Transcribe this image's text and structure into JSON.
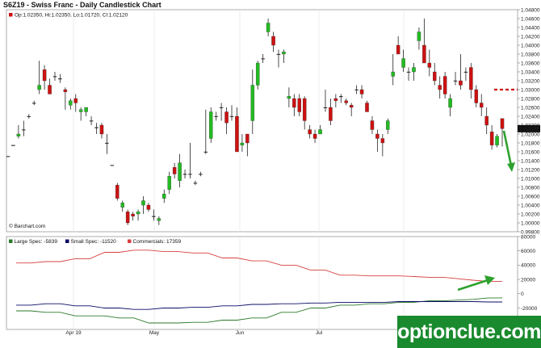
{
  "title": "S6Z19 - Swiss Franc - Daily Candlestick Chart",
  "ohlc_legend": "Op:1.02350, Hi:1.02350, Lo:1.01720, Cl:1.02120",
  "credit": "© Barchart.com",
  "last_price_label": "1.02120",
  "watermark": "optionclue.com",
  "colors": {
    "up": "#22bb22",
    "down": "#cc1111",
    "large_spec": "#2a7a2a",
    "small_spec": "#0b0b66",
    "commercials": "#d84040",
    "arrow": "#2ea12e",
    "resistance": "#cc1111"
  },
  "chart_data": [
    {
      "type": "candlestick",
      "title": "S6Z19 - Swiss Franc - Daily Candlestick Chart",
      "y_ticks": [
        "0.99800",
        "1.00000",
        "1.00200",
        "1.00400",
        "1.00600",
        "1.00800",
        "1.01000",
        "1.01200",
        "1.01400",
        "1.01600",
        "1.01800",
        "1.02000",
        "1.02200",
        "1.02400",
        "1.02600",
        "1.02800",
        "1.03000",
        "1.03200",
        "1.03400",
        "1.03600",
        "1.03800",
        "1.04000",
        "1.04200",
        "1.04400",
        "1.04600",
        "1.04800"
      ],
      "ylim": [
        0.998,
        1.048
      ],
      "x_labels": [
        "Apr 19",
        "May",
        "Jun",
        "Jul",
        "Aug"
      ],
      "candles": [
        [
          1.015,
          1.015,
          1.015,
          1.015
        ],
        [
          1.0175,
          1.0175,
          1.0175,
          1.0175
        ],
        [
          1.0195,
          1.022,
          1.019,
          1.02
        ],
        [
          1.021,
          1.023,
          1.0195,
          1.021
        ],
        [
          1.024,
          1.0245,
          1.0235,
          1.024
        ],
        [
          1.027,
          1.0275,
          1.0265,
          1.027
        ],
        [
          1.03,
          1.0365,
          1.029,
          1.031
        ],
        [
          1.0345,
          1.0355,
          1.03,
          1.032
        ],
        [
          1.031,
          1.0325,
          1.029,
          1.029
        ],
        [
          1.033,
          1.034,
          1.032,
          1.033
        ],
        [
          1.0325,
          1.0335,
          1.0315,
          1.0325
        ],
        [
          1.03,
          1.0305,
          1.0255,
          1.0295
        ],
        [
          1.0265,
          1.028,
          1.0255,
          1.0275
        ],
        [
          1.028,
          1.029,
          1.025,
          1.027
        ],
        [
          1.025,
          1.026,
          1.023,
          1.0255
        ],
        [
          1.025,
          1.026,
          1.024,
          1.026
        ],
        [
          1.023,
          1.024,
          1.022,
          1.023
        ],
        [
          1.0215,
          1.0225,
          1.02,
          1.0215
        ],
        [
          1.022,
          1.0225,
          1.019,
          1.02
        ],
        [
          1.018,
          1.02,
          1.0155,
          1.018
        ],
        [
          1.013,
          1.013,
          1.013,
          1.013
        ],
        [
          1.0085,
          1.009,
          1.005,
          1.0055
        ],
        [
          1.0035,
          1.005,
          1.0025,
          1.0045
        ],
        [
          1.0025,
          1.003,
          0.9995,
          1.0
        ],
        [
          1.002,
          1.0025,
          1.0005,
          1.0015
        ],
        [
          1.002,
          1.003,
          1.0005,
          1.0025
        ],
        [
          1.004,
          1.006,
          1.002,
          1.005
        ],
        [
          1.004,
          1.0045,
          1.0025,
          1.003
        ],
        [
          1.0015,
          1.003,
          1.0005,
          1.0015
        ],
        [
          1.0005,
          1.0015,
          0.9995,
          1.001
        ],
        [
          1.0055,
          1.0075,
          1.0045,
          1.0065
        ],
        [
          1.0075,
          1.0115,
          1.0065,
          1.0105
        ],
        [
          1.0125,
          1.0135,
          1.01,
          1.011
        ],
        [
          1.0095,
          1.0155,
          1.008,
          1.0135
        ],
        [
          1.011,
          1.012,
          1.01,
          1.011
        ],
        [
          1.011,
          1.018,
          1.01,
          1.011
        ],
        [
          1.009,
          1.0095,
          1.0085,
          1.009
        ],
        [
          1.011,
          1.0115,
          1.0105,
          1.011
        ],
        [
          1.016,
          1.0255,
          1.0155,
          1.016
        ],
        [
          1.019,
          1.026,
          1.018,
          1.025
        ],
        [
          1.024,
          1.025,
          1.023,
          1.024
        ],
        [
          1.026,
          1.027,
          1.023,
          1.026
        ],
        [
          1.025,
          1.026,
          1.02,
          1.0225
        ],
        [
          1.024,
          1.0265,
          1.023,
          1.024
        ],
        [
          1.024,
          1.026,
          1.016,
          1.016
        ],
        [
          1.0175,
          1.02,
          1.016,
          1.018
        ],
        [
          1.02,
          1.02,
          1.015,
          1.018
        ],
        [
          1.023,
          1.0345,
          1.02,
          1.031
        ],
        [
          1.031,
          1.0365,
          1.03,
          1.036
        ],
        [
          1.037,
          1.038,
          1.036,
          1.037
        ],
        [
          1.043,
          1.046,
          1.042,
          1.045
        ],
        [
          1.042,
          1.043,
          1.0385,
          1.04
        ],
        [
          1.038,
          1.039,
          1.035,
          1.038
        ],
        [
          1.038,
          1.039,
          1.036,
          1.0385
        ],
        [
          1.028,
          1.0305,
          1.026,
          1.0285
        ],
        [
          1.028,
          1.029,
          1.024,
          1.026
        ],
        [
          1.028,
          1.029,
          1.024,
          1.025
        ],
        [
          1.028,
          1.0285,
          1.021,
          1.023
        ],
        [
          1.021,
          1.022,
          1.019,
          1.02
        ],
        [
          1.02,
          1.021,
          1.018,
          1.019
        ],
        [
          1.02,
          1.022,
          1.02,
          1.021
        ],
        [
          1.026,
          1.03,
          1.025,
          1.026
        ],
        [
          1.026,
          1.028,
          1.022,
          1.023
        ],
        [
          1.028,
          1.029,
          1.026,
          1.0275
        ],
        [
          1.0285,
          1.029,
          1.027,
          1.0285
        ],
        [
          1.0275,
          1.028,
          1.0265,
          1.027
        ],
        [
          1.0265,
          1.027,
          1.024,
          1.026
        ],
        [
          1.03,
          1.031,
          1.029,
          1.03
        ],
        [
          1.03,
          1.031,
          1.028,
          1.029
        ],
        [
          1.027,
          1.0275,
          1.025,
          1.025
        ],
        [
          1.023,
          1.024,
          1.02,
          1.021
        ],
        [
          1.02,
          1.021,
          1.016,
          1.019
        ],
        [
          1.019,
          1.02,
          1.015,
          1.018
        ],
        [
          1.021,
          1.0235,
          1.02,
          1.023
        ],
        [
          1.033,
          1.038,
          1.031,
          1.034
        ],
        [
          1.04,
          1.042,
          1.038,
          1.038
        ],
        [
          1.035,
          1.039,
          1.034,
          1.037
        ],
        [
          1.034,
          1.035,
          1.032,
          1.034
        ],
        [
          1.034,
          1.036,
          1.032,
          1.035
        ],
        [
          1.041,
          1.044,
          1.039,
          1.043
        ],
        [
          1.04,
          1.046,
          1.036,
          1.036
        ],
        [
          1.036,
          1.039,
          1.033,
          1.035
        ],
        [
          1.034,
          1.036,
          1.031,
          1.032
        ],
        [
          1.031,
          1.033,
          1.028,
          1.03
        ],
        [
          1.033,
          1.034,
          1.028,
          1.029
        ],
        [
          1.026,
          1.029,
          1.024,
          1.028
        ],
        [
          1.032,
          1.034,
          1.031,
          1.032
        ],
        [
          1.032,
          1.038,
          1.03,
          1.031
        ],
        [
          1.034,
          1.035,
          1.032,
          1.034
        ],
        [
          1.035,
          1.036,
          1.028,
          1.03
        ],
        [
          1.03,
          1.031,
          1.026,
          1.027
        ],
        [
          1.027,
          1.029,
          1.024,
          1.026
        ],
        [
          1.024,
          1.026,
          1.02,
          1.022
        ],
        [
          1.0205,
          1.022,
          1.0165,
          1.0175
        ],
        [
          1.0175,
          1.02,
          1.017,
          1.0195
        ],
        [
          1.0235,
          1.0235,
          1.0172,
          1.0212
        ]
      ],
      "resistance_level": 1.03
    },
    {
      "type": "line",
      "title": "COT",
      "y_ticks": [
        "-40000",
        "-20000",
        "0",
        "20000",
        "40000",
        "60000",
        "80000"
      ],
      "ylim": [
        -50000,
        80000
      ],
      "legend": [
        {
          "name": "Large Spec: -5839"
        },
        {
          "name": "Small Spec: -11520"
        },
        {
          "name": "Commercials: 17359"
        }
      ],
      "series": [
        {
          "name": "Large Spec",
          "values": [
            -24000,
            -24000,
            -26000,
            -26000,
            -31000,
            -31000,
            -31000,
            -34000,
            -34000,
            -41000,
            -41000,
            -41000,
            -40000,
            -40000,
            -37000,
            -37000,
            -34000,
            -34000,
            -26000,
            -26000,
            -20000,
            -20000,
            -16000,
            -16000,
            -14000,
            -14000,
            -12000,
            -12000,
            -10000,
            -10000,
            -9000,
            -8000,
            -6000,
            -5839
          ]
        },
        {
          "name": "Small Spec",
          "values": [
            -16000,
            -16000,
            -14000,
            -14000,
            -17000,
            -17000,
            -20000,
            -20000,
            -22000,
            -22000,
            -20000,
            -20000,
            -19000,
            -19000,
            -17000,
            -17000,
            -15000,
            -15000,
            -14000,
            -14000,
            -13000,
            -13000,
            -12000,
            -12000,
            -12000,
            -12000,
            -11000,
            -11000,
            -11000,
            -11000,
            -11000,
            -11000,
            -11520,
            -11520
          ]
        },
        {
          "name": "Commercials",
          "values": [
            43000,
            43000,
            45000,
            45000,
            49000,
            49000,
            58000,
            58000,
            61000,
            61000,
            59000,
            59000,
            57000,
            57000,
            50000,
            50000,
            46000,
            46000,
            40000,
            40000,
            33000,
            33000,
            26000,
            26000,
            25000,
            25000,
            25000,
            24000,
            23000,
            23000,
            21000,
            19000,
            17359,
            17359
          ]
        }
      ]
    }
  ]
}
